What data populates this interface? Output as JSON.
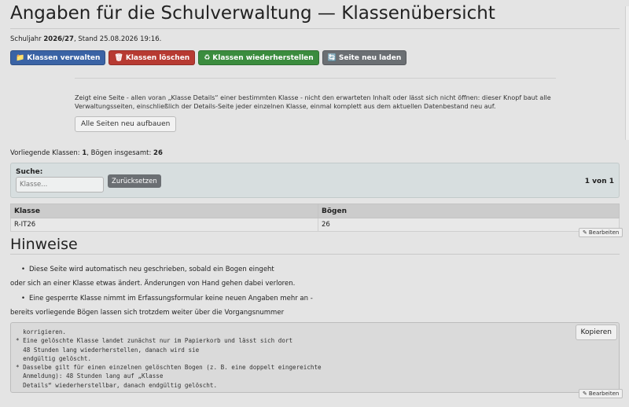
{
  "header": {
    "title": "Angaben für die Schulverwaltung — Klassenübersicht",
    "meta_prefix": "Schuljahr ",
    "school_year": "2026/27",
    "meta_suffix": ", Stand 25.08.2026 19:16."
  },
  "toolbar": {
    "manage": {
      "icon": "📁",
      "label": "Klassen verwalten"
    },
    "delete": {
      "icon": "🗑",
      "label": "Klassen löschen"
    },
    "restore": {
      "icon": "♻",
      "label": "Klassen wiederherstellen"
    },
    "reload": {
      "icon": "🔄",
      "label": "Seite neu laden"
    }
  },
  "rebuild": {
    "text": "Zeigt eine Seite - allen voran „Klasse Details“ einer bestimmten Klasse - nicht den erwarteten Inhalt oder lässt sich nicht öffnen: dieser Knopf baut alle Verwaltungsseiten, einschließlich der Details-Seite jeder einzelnen Klasse, einmal komplett aus dem aktuellen Datenbestand neu auf.",
    "button": "Alle Seiten neu aufbauen"
  },
  "counts": {
    "classes_label": "Vorliegende Klassen: ",
    "classes": "1",
    "sheets_label": ", Bögen insgesamt: ",
    "sheets": "26"
  },
  "search": {
    "label": "Suche:",
    "placeholder": "Klasse...",
    "reset": "Zurücksetzen",
    "pager": "1 von 1"
  },
  "table": {
    "headers": [
      "Klasse",
      "Bögen"
    ],
    "rows": [
      [
        "R-IT26",
        "26"
      ]
    ]
  },
  "edit_label": "Bearbeiten",
  "hints": {
    "title": "Hinweise",
    "li1": "Diese Seite wird automatisch neu geschrieben, sobald ein Bogen eingeht",
    "p1": "oder sich an einer Klasse etwas ändert. Änderungen von Hand gehen dabei verloren.",
    "li2": "Eine gesperrte Klasse nimmt im Erfassungsformular keine neuen Angaben mehr an -",
    "p2": "bereits vorliegende Bögen lassen sich trotzdem weiter über die Vorgangsnummer"
  },
  "code": {
    "text": "  korrigieren.\n* Eine gelöschte Klasse landet zunächst nur im Papierkorb und lässt sich dort\n  48 Stunden lang wiederherstellen, danach wird sie\n  endgültig gelöscht.\n* Dasselbe gilt für einen einzelnen gelöschten Bogen (z. B. eine doppelt eingereichte\n  Anmeldung): 48 Stunden lang auf „Klasse\n  Details“ wiederherstellbar, danach endgültig gelöscht.",
    "copy": "Kopieren"
  }
}
